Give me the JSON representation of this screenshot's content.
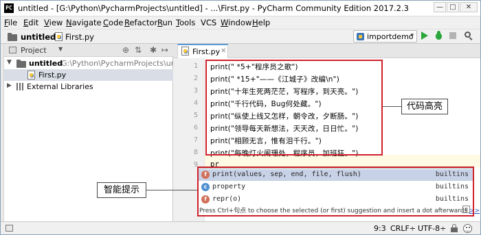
{
  "window": {
    "title": "untitled - [G:\\Python\\PycharmProjects\\untitled] - ...\\First.py - PyCharm Community Edition 2017.2.3",
    "app_icon": "PC",
    "controls": {
      "minimize": "—",
      "maximize": "□",
      "close": "✕"
    }
  },
  "menu": {
    "items": [
      {
        "u": "F",
        "rest": "ile"
      },
      {
        "u": "E",
        "rest": "dit"
      },
      {
        "u": "V",
        "rest": "iew"
      },
      {
        "u": "N",
        "rest": "avigate"
      },
      {
        "u": "C",
        "rest": "ode"
      },
      {
        "u": "R",
        "rest": "efactor"
      },
      {
        "u": "R",
        "rest": "un"
      },
      {
        "u": "T",
        "rest": "ools"
      },
      {
        "u": "",
        "rest": "VCS"
      },
      {
        "u": "W",
        "rest": "indow"
      },
      {
        "u": "H",
        "rest": "elp"
      }
    ]
  },
  "navbar": {
    "project": "untitled",
    "file": "First.py",
    "run_config": "importdemo"
  },
  "project_panel": {
    "header": "Project",
    "tree": {
      "root_name": "untitled",
      "root_path": "G:\\Python\\PycharmProjects\\untitled",
      "file": "First.py",
      "libraries": "External Libraries"
    }
  },
  "editor": {
    "tab": "First.py",
    "line_numbers": [
      "1",
      "2",
      "3",
      "4",
      "5",
      "6",
      "7",
      "8",
      "9"
    ],
    "lines": [
      "print(\"  *5+\"程序员之歌\")",
      "print(\"  *15+\"——《江城子》改编\\n\")",
      "print(\"十年生死两茫茫，写程序，到天亮。\")",
      "print(\"千行代码，Bug何处藏。\")",
      "print(\"纵使上线又怎样，朝令改，夕断肠。\")",
      "print(\"领导每天新想法，天天改，日日忙。\")",
      "print(\"相顾无言，惟有泪千行。\")",
      "print(\"每晚灯火阑珊处，程序员，加班狂。\")",
      "pr"
    ]
  },
  "annotations": {
    "code_highlight": "代码高亮",
    "smart_hint": "智能提示"
  },
  "completion": {
    "items": [
      {
        "icon": "f",
        "text": "print(values, sep, end, file, flush)",
        "source": "builtins"
      },
      {
        "icon": "c",
        "text": "property",
        "source": "builtins"
      },
      {
        "icon": "f",
        "text": "repr(o)",
        "source": "builtins"
      }
    ],
    "hint": "Press Ctrl+句点 to choose the selected (or first) suggestion and insert a dot afterwards",
    "hint_link": ">>",
    "pi_symbol": "π"
  },
  "status": {
    "position": "9:3",
    "line_sep": "CRLF÷",
    "encoding": "UTF-8÷"
  },
  "colors": {
    "annotation_red": "#d0202b",
    "run_green": "#2aa63a",
    "selection_blue": "#c8d2e6"
  }
}
